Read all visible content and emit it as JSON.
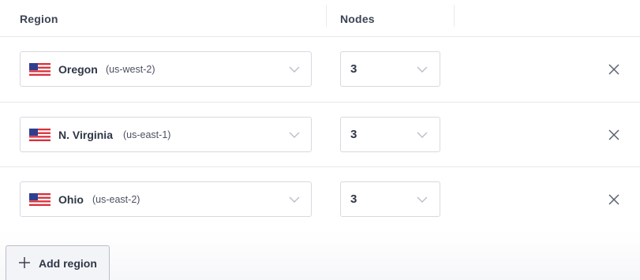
{
  "header": {
    "region_label": "Region",
    "nodes_label": "Nodes"
  },
  "rows": [
    {
      "flag": "us-flag-icon",
      "name": "Oregon",
      "code": "(us-west-2)",
      "nodes": "3"
    },
    {
      "flag": "us-flag-icon",
      "name": "N. Virginia",
      "code": "(us-east-1)",
      "nodes": "3"
    },
    {
      "flag": "us-flag-icon",
      "name": "Ohio",
      "code": "(us-east-2)",
      "nodes": "3"
    }
  ],
  "actions": {
    "add_region_label": "Add region",
    "remove_icon": "close-icon",
    "dropdown_icon": "chevron-down-icon"
  },
  "colors": {
    "border": "#d6dae0",
    "text": "#2f3646",
    "flag_red": "#d9303b",
    "flag_blue": "#2f3f8f"
  }
}
